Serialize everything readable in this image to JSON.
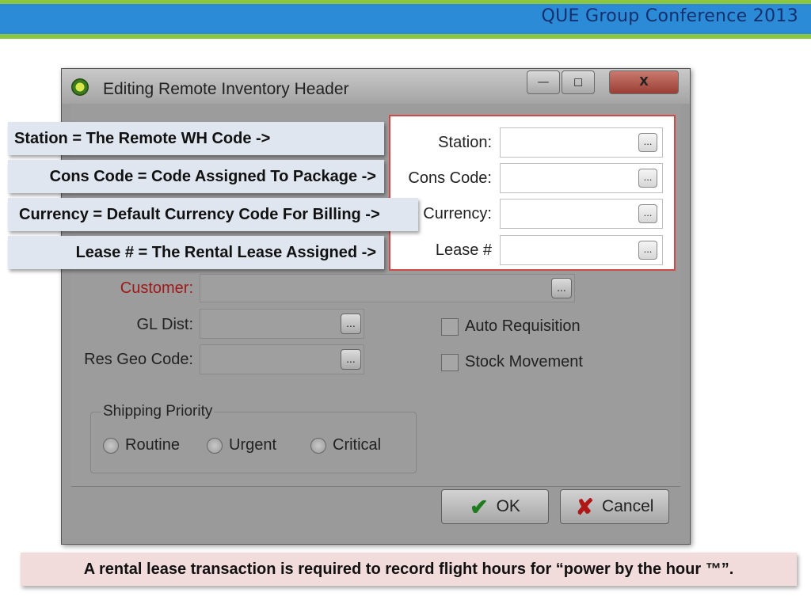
{
  "slide": {
    "header_title": "QUE Group Conference 2013"
  },
  "window": {
    "title": "Editing Remote Inventory Header",
    "controls": {
      "minimize": "—",
      "maximize": "◻",
      "close": "X"
    }
  },
  "form": {
    "customer_label": "Customer:",
    "gl_dist_label": "GL Dist:",
    "res_geo_code_label": "Res Geo Code:",
    "auto_requisition_label": "Auto Requisition",
    "stock_movement_label": "Stock Movement",
    "shipping_priority": {
      "title": "Shipping Priority",
      "options": [
        "Routine",
        "Urgent",
        "Critical"
      ]
    },
    "ok_label": "OK",
    "cancel_label": "Cancel",
    "ellipsis": "..."
  },
  "zoom_panel": {
    "station_label": "Station:",
    "cons_code_label": "Cons Code:",
    "currency_label": "Currency:",
    "lease_label": "Lease #"
  },
  "callouts": {
    "station": "Station = The Remote WH Code ->",
    "cons_code": "Cons Code = Code Assigned To Package ->",
    "currency": "Currency = Default Currency Code For Billing ->",
    "lease": "Lease # = The Rental Lease Assigned ->"
  },
  "bottom_note": "A rental lease transaction is required to record flight hours for “power by the hour ™”."
}
